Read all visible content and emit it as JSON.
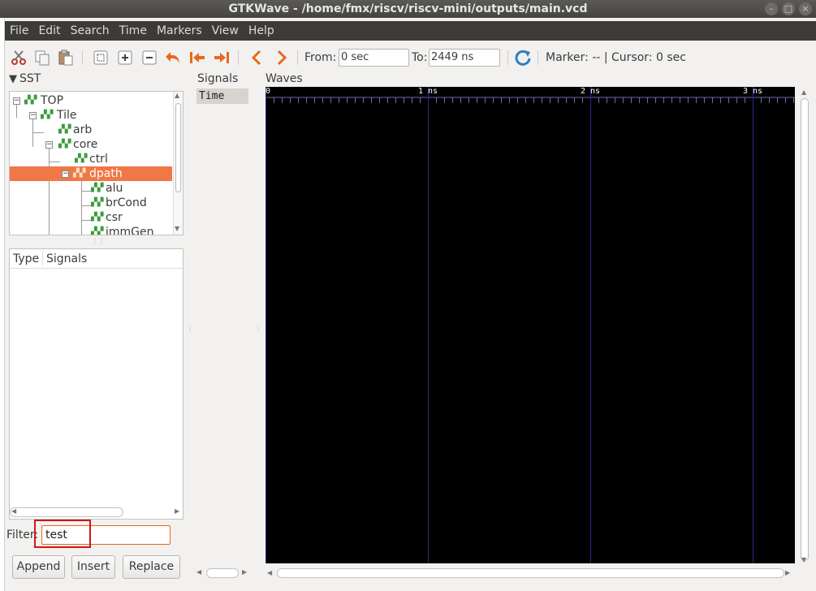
{
  "window": {
    "title": "GTKWave - /home/fmx/riscv/riscv-mini/outputs/main.vcd"
  },
  "menubar": {
    "items": [
      "File",
      "Edit",
      "Search",
      "Time",
      "Markers",
      "View",
      "Help"
    ]
  },
  "toolbar": {
    "from_label": "From:",
    "from_value": "0 sec",
    "to_label": "To:",
    "to_value": "2449 ns",
    "marker_cursor": "Marker: -- | Cursor: 0 sec"
  },
  "sst": {
    "label": "SST",
    "tree": [
      {
        "label": "TOP",
        "level": 0,
        "expanded": true
      },
      {
        "label": "Tile",
        "level": 1,
        "expanded": true
      },
      {
        "label": "arb",
        "level": 2
      },
      {
        "label": "core",
        "level": 2,
        "expanded": true
      },
      {
        "label": "ctrl",
        "level": 3
      },
      {
        "label": "dpath",
        "level": 3,
        "expanded": true,
        "selected": true
      },
      {
        "label": "alu",
        "level": 4
      },
      {
        "label": "brCond",
        "level": 4
      },
      {
        "label": "csr",
        "level": 4
      },
      {
        "label": "immGen",
        "level": 4
      }
    ]
  },
  "signal_list": {
    "type_header": "Type",
    "signals_header": "Signals"
  },
  "filter": {
    "label": "Filter:",
    "value": "test"
  },
  "buttons": {
    "append": "Append",
    "insert": "Insert",
    "replace": "Replace"
  },
  "signals_pane": {
    "label": "Signals",
    "items": [
      "Time"
    ]
  },
  "waves_pane": {
    "label": "Waves",
    "ticks": [
      "0",
      "1 ns",
      "2 ns",
      "3 ns"
    ]
  },
  "colors": {
    "selection": "#f07746",
    "menubar": "#3c3b37",
    "accent_icon": "#e8681f",
    "wave_bg": "#000000",
    "grid": "#2b2b8a"
  }
}
